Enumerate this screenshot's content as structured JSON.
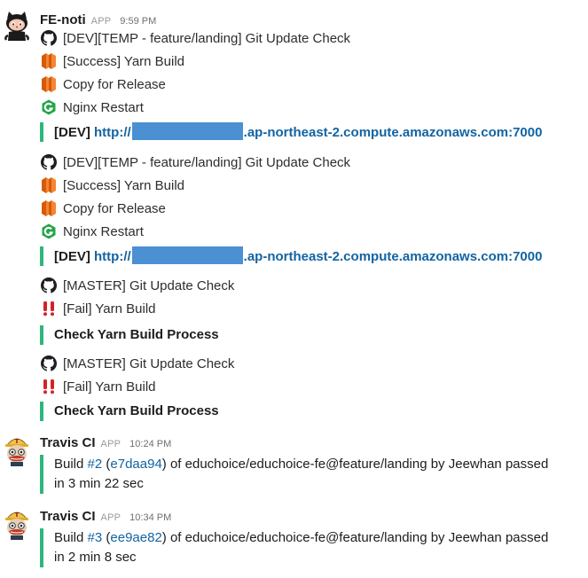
{
  "bot1": {
    "name": "FE-noti",
    "badge": "APP",
    "time": "9:59 PM",
    "groups": [
      {
        "lines": [
          "[DEV][TEMP - feature/landing] Git Update Check",
          "[Success] Yarn Build",
          "Copy for Release",
          "Nginx Restart"
        ],
        "icons": [
          "github-icon",
          "aws-icon",
          "aws-icon",
          "nginx-icon"
        ],
        "attach_label": "[DEV]",
        "link_prefix": "http://",
        "link_suffix": ".ap-northeast-2.compute.amazonaws.com:7000"
      },
      {
        "lines": [
          "[DEV][TEMP - feature/landing] Git Update Check",
          "[Success] Yarn Build",
          "Copy for Release",
          "Nginx Restart"
        ],
        "icons": [
          "github-icon",
          "aws-icon",
          "aws-icon",
          "nginx-icon"
        ],
        "attach_label": "[DEV]",
        "link_prefix": "http://",
        "link_suffix": ".ap-northeast-2.compute.amazonaws.com:7000"
      },
      {
        "lines": [
          "[MASTER] Git Update Check",
          "[Fail] Yarn Build"
        ],
        "icons": [
          "github-icon",
          "double-exclamation-icon"
        ],
        "attach_text": "Check Yarn Build Process"
      },
      {
        "lines": [
          "[MASTER] Git Update Check",
          "[Fail] Yarn Build"
        ],
        "icons": [
          "github-icon",
          "double-exclamation-icon"
        ],
        "attach_text": "Check Yarn Build Process"
      }
    ]
  },
  "travis": [
    {
      "name": "Travis CI",
      "badge": "APP",
      "time": "10:24 PM",
      "pre": "Build ",
      "build": "#2",
      "open": " (",
      "commit": "e7daa94",
      "post": ") of educhoice/educhoice-fe@feature/landing by Jeewhan passed in 3 min 22 sec"
    },
    {
      "name": "Travis CI",
      "badge": "APP",
      "time": "10:34 PM",
      "pre": "Build ",
      "build": "#3",
      "open": " (",
      "commit": "ee9ae82",
      "post": ") of educhoice/educhoice-fe@feature/landing by Jeewhan passed in 2 min 8 sec"
    }
  ],
  "colors": {
    "attachment_bar": "#2eb67d",
    "link": "#1264a3",
    "redaction": "#4a90d2"
  }
}
